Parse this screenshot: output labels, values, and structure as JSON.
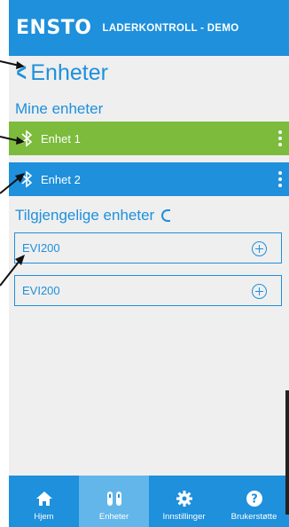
{
  "header": {
    "logo": "ENSTO",
    "title": "LADERKONTROLL - DEMO"
  },
  "nav": {
    "back_icon": "chevron-left-icon",
    "page_title": "Enheter"
  },
  "my_devices": {
    "heading": "Mine enheter",
    "items": [
      {
        "label": "Enhet 1",
        "color": "#7cbb3c",
        "icon": "bluetooth-icon"
      },
      {
        "label": "Enhet 2",
        "color": "#1e90dc",
        "icon": "bluetooth-icon"
      }
    ]
  },
  "available_devices": {
    "heading": "Tilgjengelige enheter",
    "items": [
      {
        "label": "EVI200"
      },
      {
        "label": "EVI200"
      }
    ]
  },
  "tabs": [
    {
      "label": "Hjem",
      "icon": "home-icon",
      "active": false
    },
    {
      "label": "Enheter",
      "icon": "devices-icon",
      "active": true
    },
    {
      "label": "Innstillinger",
      "icon": "gear-icon",
      "active": false
    },
    {
      "label": "Brukerstøtte",
      "icon": "help-icon",
      "active": false
    }
  ],
  "colors": {
    "brand_blue": "#1e90dc",
    "green": "#7cbb3c",
    "background": "#efefef",
    "active_tab": "#63b6ea"
  }
}
